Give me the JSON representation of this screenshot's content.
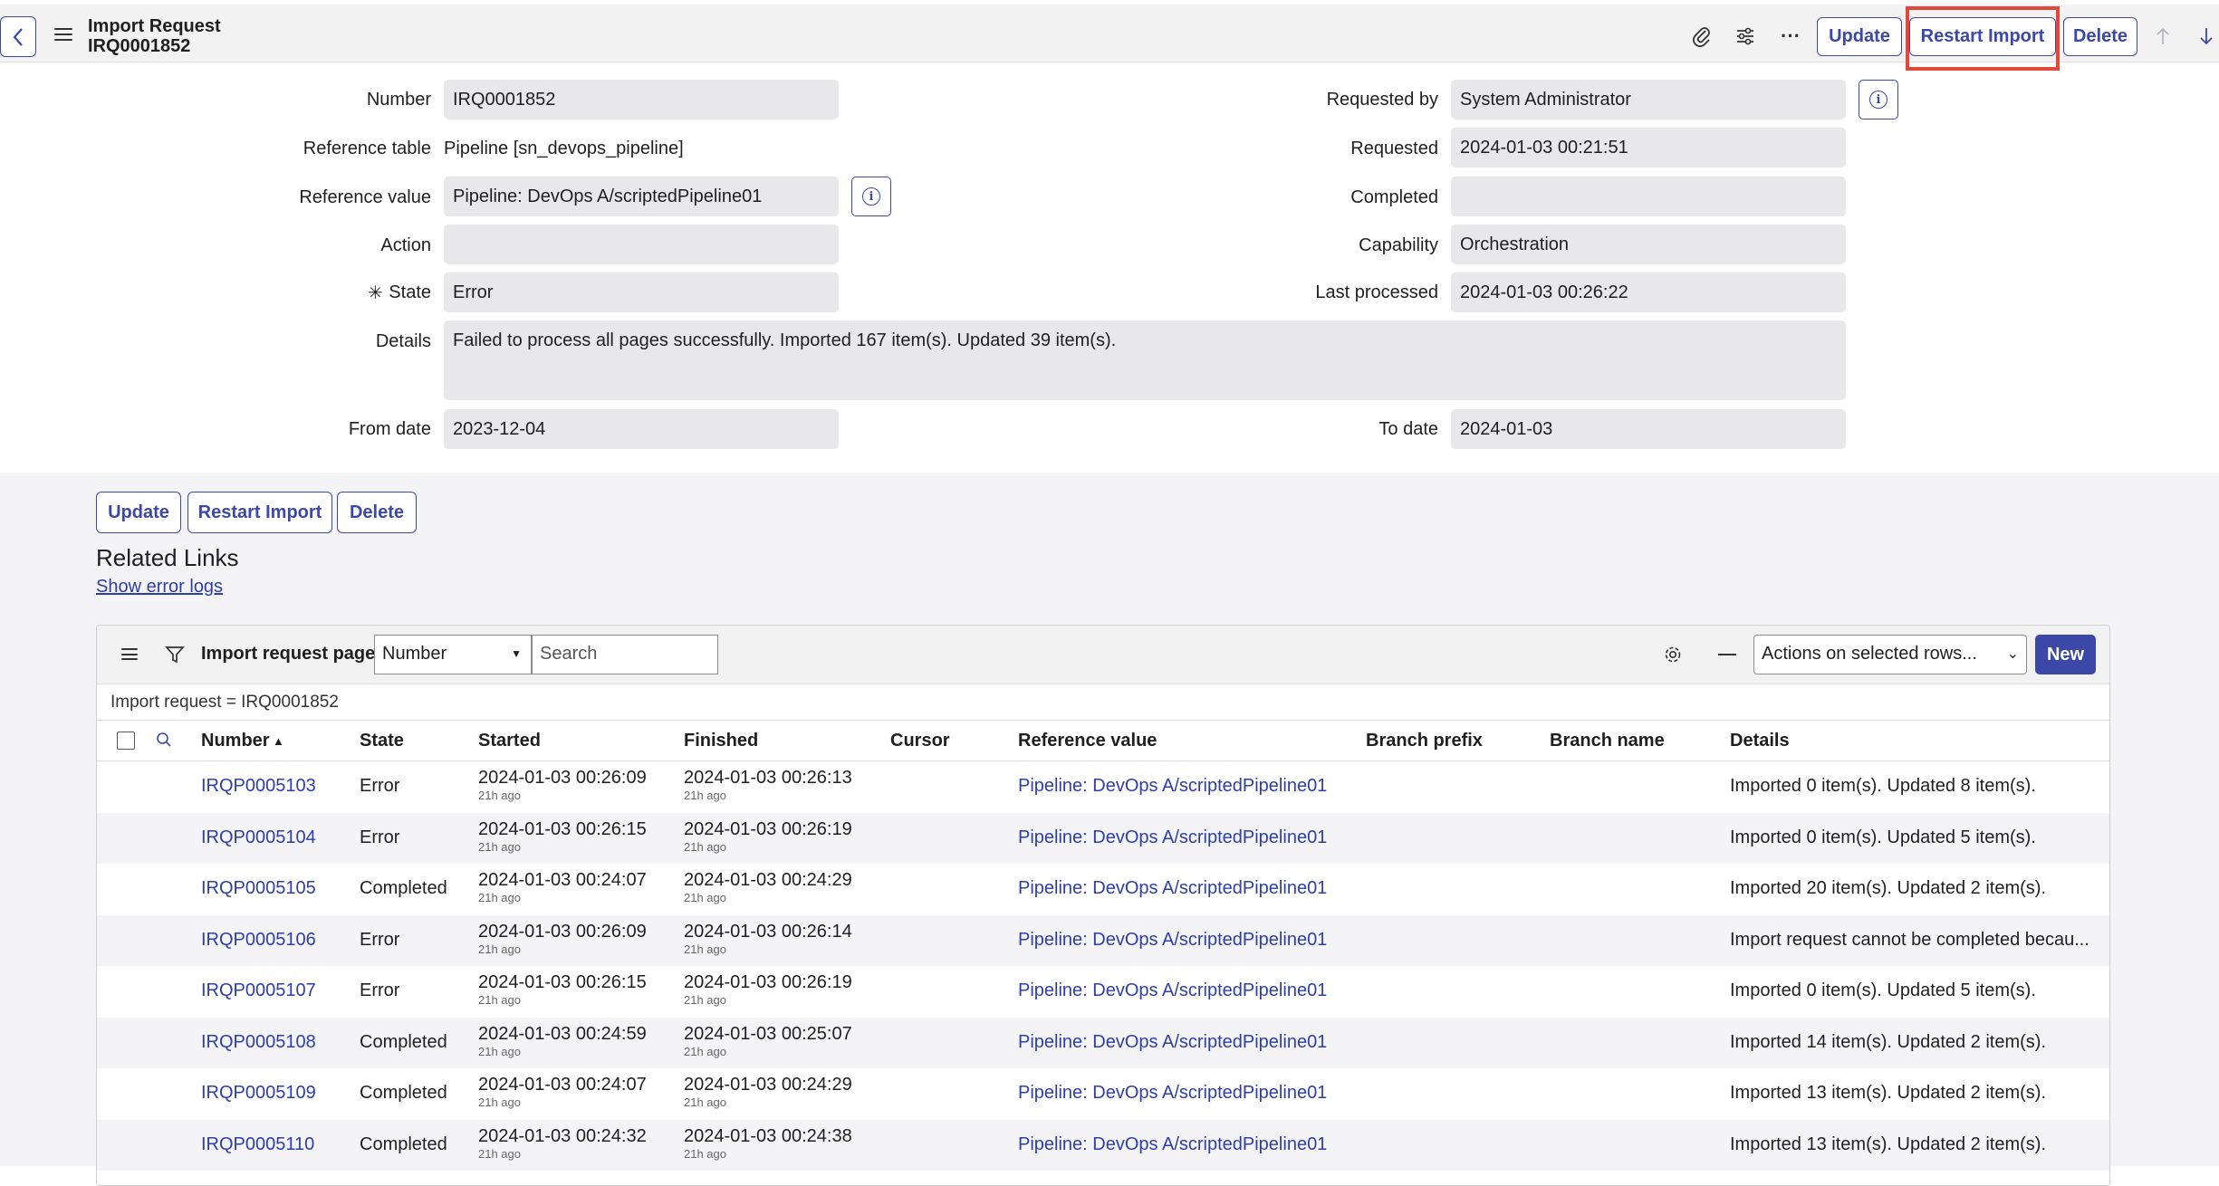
{
  "header": {
    "title": "Import Request",
    "number": "IRQ0001852",
    "update_label": "Update",
    "restart_label": "Restart Import",
    "delete_label": "Delete"
  },
  "form": {
    "number_label": "Number",
    "number_value": "IRQ0001852",
    "reference_table_label": "Reference table",
    "reference_table_value": "Pipeline [sn_devops_pipeline]",
    "reference_value_label": "Reference value",
    "reference_value_value": "Pipeline: DevOps A/scriptedPipeline01",
    "action_label": "Action",
    "action_value": "",
    "state_label": "State",
    "state_required_mark": "✳",
    "state_value": "Error",
    "details_label": "Details",
    "details_value": "Failed to process all pages successfully. Imported 167 item(s). Updated 39 item(s).",
    "from_date_label": "From date",
    "from_date_value": "2023-12-04",
    "requested_by_label": "Requested by",
    "requested_by_value": "System Administrator",
    "requested_label": "Requested",
    "requested_value": "2024-01-03 00:21:51",
    "completed_label": "Completed",
    "completed_value": "",
    "capability_label": "Capability",
    "capability_value": "Orchestration",
    "last_processed_label": "Last processed",
    "last_processed_value": "2024-01-03 00:26:22",
    "to_date_label": "To date",
    "to_date_value": "2024-01-03"
  },
  "bottom_buttons": {
    "update_label": "Update",
    "restart_label": "Restart Import",
    "delete_label": "Delete"
  },
  "related": {
    "title": "Related Links",
    "show_error_logs": "Show error logs"
  },
  "list": {
    "title": "Import request pages",
    "search_field": "Number",
    "search_placeholder": "Search",
    "actions_label": "Actions on selected rows...",
    "new_label": "New",
    "filter": "Import request = IRQ0001852",
    "columns": [
      "Number",
      "State",
      "Started",
      "Finished",
      "Cursor",
      "Reference value",
      "Branch prefix",
      "Branch name",
      "Details"
    ],
    "sort_indicator": "▲",
    "rows": [
      {
        "number": "IRQP0005103",
        "state": "Error",
        "started": "2024-01-03 00:26:09",
        "started_ago": "21h ago",
        "finished": "2024-01-03 00:26:13",
        "finished_ago": "21h ago",
        "reference": "Pipeline: DevOps A/scriptedPipeline01",
        "details": "Imported 0 item(s). Updated 8 item(s)."
      },
      {
        "number": "IRQP0005104",
        "state": "Error",
        "started": "2024-01-03 00:26:15",
        "started_ago": "21h ago",
        "finished": "2024-01-03 00:26:19",
        "finished_ago": "21h ago",
        "reference": "Pipeline: DevOps A/scriptedPipeline01",
        "details": "Imported 0 item(s). Updated 5 item(s)."
      },
      {
        "number": "IRQP0005105",
        "state": "Completed",
        "started": "2024-01-03 00:24:07",
        "started_ago": "21h ago",
        "finished": "2024-01-03 00:24:29",
        "finished_ago": "21h ago",
        "reference": "Pipeline: DevOps A/scriptedPipeline01",
        "details": "Imported 20 item(s). Updated 2 item(s)."
      },
      {
        "number": "IRQP0005106",
        "state": "Error",
        "started": "2024-01-03 00:26:09",
        "started_ago": "21h ago",
        "finished": "2024-01-03 00:26:14",
        "finished_ago": "21h ago",
        "reference": "Pipeline: DevOps A/scriptedPipeline01",
        "details": "Import request cannot be completed becau..."
      },
      {
        "number": "IRQP0005107",
        "state": "Error",
        "started": "2024-01-03 00:26:15",
        "started_ago": "21h ago",
        "finished": "2024-01-03 00:26:19",
        "finished_ago": "21h ago",
        "reference": "Pipeline: DevOps A/scriptedPipeline01",
        "details": "Imported 0 item(s). Updated 5 item(s)."
      },
      {
        "number": "IRQP0005108",
        "state": "Completed",
        "started": "2024-01-03 00:24:59",
        "started_ago": "21h ago",
        "finished": "2024-01-03 00:25:07",
        "finished_ago": "21h ago",
        "reference": "Pipeline: DevOps A/scriptedPipeline01",
        "details": "Imported 14 item(s). Updated 2 item(s)."
      },
      {
        "number": "IRQP0005109",
        "state": "Completed",
        "started": "2024-01-03 00:24:07",
        "started_ago": "21h ago",
        "finished": "2024-01-03 00:24:29",
        "finished_ago": "21h ago",
        "reference": "Pipeline: DevOps A/scriptedPipeline01",
        "details": "Imported 13 item(s). Updated 2 item(s)."
      },
      {
        "number": "IRQP0005110",
        "state": "Completed",
        "started": "2024-01-03 00:24:32",
        "started_ago": "21h ago",
        "finished": "2024-01-03 00:24:38",
        "finished_ago": "21h ago",
        "reference": "Pipeline: DevOps A/scriptedPipeline01",
        "details": "Imported 13 item(s). Updated 2 item(s)."
      }
    ]
  }
}
